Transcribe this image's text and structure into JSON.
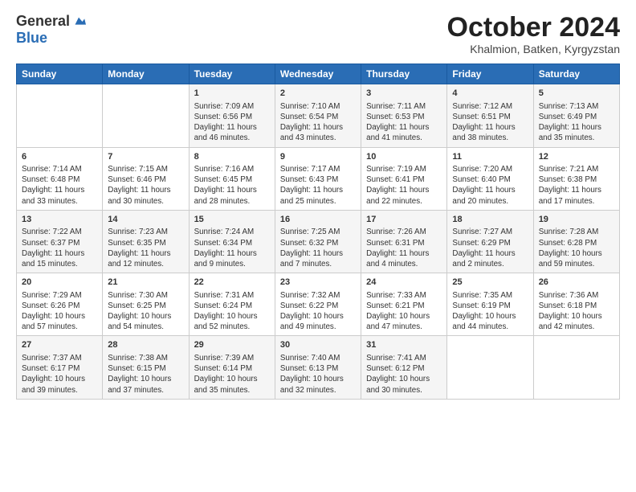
{
  "logo": {
    "general": "General",
    "blue": "Blue"
  },
  "header": {
    "month": "October 2024",
    "location": "Khalmion, Batken, Kyrgyzstan"
  },
  "weekdays": [
    "Sunday",
    "Monday",
    "Tuesday",
    "Wednesday",
    "Thursday",
    "Friday",
    "Saturday"
  ],
  "weeks": [
    [
      {
        "day": "",
        "sunrise": "",
        "sunset": "",
        "daylight": ""
      },
      {
        "day": "",
        "sunrise": "",
        "sunset": "",
        "daylight": ""
      },
      {
        "day": "1",
        "sunrise": "Sunrise: 7:09 AM",
        "sunset": "Sunset: 6:56 PM",
        "daylight": "Daylight: 11 hours and 46 minutes."
      },
      {
        "day": "2",
        "sunrise": "Sunrise: 7:10 AM",
        "sunset": "Sunset: 6:54 PM",
        "daylight": "Daylight: 11 hours and 43 minutes."
      },
      {
        "day": "3",
        "sunrise": "Sunrise: 7:11 AM",
        "sunset": "Sunset: 6:53 PM",
        "daylight": "Daylight: 11 hours and 41 minutes."
      },
      {
        "day": "4",
        "sunrise": "Sunrise: 7:12 AM",
        "sunset": "Sunset: 6:51 PM",
        "daylight": "Daylight: 11 hours and 38 minutes."
      },
      {
        "day": "5",
        "sunrise": "Sunrise: 7:13 AM",
        "sunset": "Sunset: 6:49 PM",
        "daylight": "Daylight: 11 hours and 35 minutes."
      }
    ],
    [
      {
        "day": "6",
        "sunrise": "Sunrise: 7:14 AM",
        "sunset": "Sunset: 6:48 PM",
        "daylight": "Daylight: 11 hours and 33 minutes."
      },
      {
        "day": "7",
        "sunrise": "Sunrise: 7:15 AM",
        "sunset": "Sunset: 6:46 PM",
        "daylight": "Daylight: 11 hours and 30 minutes."
      },
      {
        "day": "8",
        "sunrise": "Sunrise: 7:16 AM",
        "sunset": "Sunset: 6:45 PM",
        "daylight": "Daylight: 11 hours and 28 minutes."
      },
      {
        "day": "9",
        "sunrise": "Sunrise: 7:17 AM",
        "sunset": "Sunset: 6:43 PM",
        "daylight": "Daylight: 11 hours and 25 minutes."
      },
      {
        "day": "10",
        "sunrise": "Sunrise: 7:19 AM",
        "sunset": "Sunset: 6:41 PM",
        "daylight": "Daylight: 11 hours and 22 minutes."
      },
      {
        "day": "11",
        "sunrise": "Sunrise: 7:20 AM",
        "sunset": "Sunset: 6:40 PM",
        "daylight": "Daylight: 11 hours and 20 minutes."
      },
      {
        "day": "12",
        "sunrise": "Sunrise: 7:21 AM",
        "sunset": "Sunset: 6:38 PM",
        "daylight": "Daylight: 11 hours and 17 minutes."
      }
    ],
    [
      {
        "day": "13",
        "sunrise": "Sunrise: 7:22 AM",
        "sunset": "Sunset: 6:37 PM",
        "daylight": "Daylight: 11 hours and 15 minutes."
      },
      {
        "day": "14",
        "sunrise": "Sunrise: 7:23 AM",
        "sunset": "Sunset: 6:35 PM",
        "daylight": "Daylight: 11 hours and 12 minutes."
      },
      {
        "day": "15",
        "sunrise": "Sunrise: 7:24 AM",
        "sunset": "Sunset: 6:34 PM",
        "daylight": "Daylight: 11 hours and 9 minutes."
      },
      {
        "day": "16",
        "sunrise": "Sunrise: 7:25 AM",
        "sunset": "Sunset: 6:32 PM",
        "daylight": "Daylight: 11 hours and 7 minutes."
      },
      {
        "day": "17",
        "sunrise": "Sunrise: 7:26 AM",
        "sunset": "Sunset: 6:31 PM",
        "daylight": "Daylight: 11 hours and 4 minutes."
      },
      {
        "day": "18",
        "sunrise": "Sunrise: 7:27 AM",
        "sunset": "Sunset: 6:29 PM",
        "daylight": "Daylight: 11 hours and 2 minutes."
      },
      {
        "day": "19",
        "sunrise": "Sunrise: 7:28 AM",
        "sunset": "Sunset: 6:28 PM",
        "daylight": "Daylight: 10 hours and 59 minutes."
      }
    ],
    [
      {
        "day": "20",
        "sunrise": "Sunrise: 7:29 AM",
        "sunset": "Sunset: 6:26 PM",
        "daylight": "Daylight: 10 hours and 57 minutes."
      },
      {
        "day": "21",
        "sunrise": "Sunrise: 7:30 AM",
        "sunset": "Sunset: 6:25 PM",
        "daylight": "Daylight: 10 hours and 54 minutes."
      },
      {
        "day": "22",
        "sunrise": "Sunrise: 7:31 AM",
        "sunset": "Sunset: 6:24 PM",
        "daylight": "Daylight: 10 hours and 52 minutes."
      },
      {
        "day": "23",
        "sunrise": "Sunrise: 7:32 AM",
        "sunset": "Sunset: 6:22 PM",
        "daylight": "Daylight: 10 hours and 49 minutes."
      },
      {
        "day": "24",
        "sunrise": "Sunrise: 7:33 AM",
        "sunset": "Sunset: 6:21 PM",
        "daylight": "Daylight: 10 hours and 47 minutes."
      },
      {
        "day": "25",
        "sunrise": "Sunrise: 7:35 AM",
        "sunset": "Sunset: 6:19 PM",
        "daylight": "Daylight: 10 hours and 44 minutes."
      },
      {
        "day": "26",
        "sunrise": "Sunrise: 7:36 AM",
        "sunset": "Sunset: 6:18 PM",
        "daylight": "Daylight: 10 hours and 42 minutes."
      }
    ],
    [
      {
        "day": "27",
        "sunrise": "Sunrise: 7:37 AM",
        "sunset": "Sunset: 6:17 PM",
        "daylight": "Daylight: 10 hours and 39 minutes."
      },
      {
        "day": "28",
        "sunrise": "Sunrise: 7:38 AM",
        "sunset": "Sunset: 6:15 PM",
        "daylight": "Daylight: 10 hours and 37 minutes."
      },
      {
        "day": "29",
        "sunrise": "Sunrise: 7:39 AM",
        "sunset": "Sunset: 6:14 PM",
        "daylight": "Daylight: 10 hours and 35 minutes."
      },
      {
        "day": "30",
        "sunrise": "Sunrise: 7:40 AM",
        "sunset": "Sunset: 6:13 PM",
        "daylight": "Daylight: 10 hours and 32 minutes."
      },
      {
        "day": "31",
        "sunrise": "Sunrise: 7:41 AM",
        "sunset": "Sunset: 6:12 PM",
        "daylight": "Daylight: 10 hours and 30 minutes."
      },
      {
        "day": "",
        "sunrise": "",
        "sunset": "",
        "daylight": ""
      },
      {
        "day": "",
        "sunrise": "",
        "sunset": "",
        "daylight": ""
      }
    ]
  ]
}
